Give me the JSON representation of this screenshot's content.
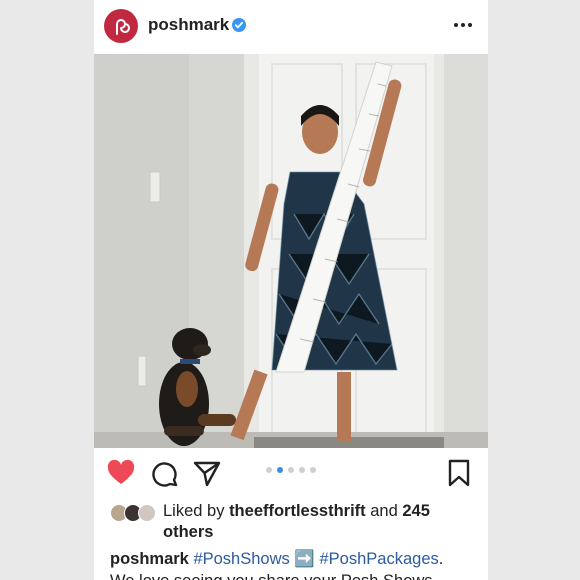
{
  "post": {
    "username": "poshmark",
    "verified": true
  },
  "icons": {
    "avatar": "poshmark-logo-icon",
    "verified": "verified-badge-icon",
    "more": "more-options-icon",
    "like": "heart-icon",
    "comment": "comment-icon",
    "share": "share-icon",
    "save": "bookmark-icon"
  },
  "carousel": {
    "count": 5,
    "active_index": 1
  },
  "likes": {
    "prefix": "Liked by",
    "user": "theeffortlessthrift",
    "middle": "and",
    "count_text": "245 others"
  },
  "caption": {
    "username": "poshmark",
    "tag1": "#PoshShows",
    "arrow": "➡️",
    "tag2": "#PoshPackages",
    "period": ".",
    "line2": "We love seeing you share your Posh Shows"
  },
  "colors": {
    "brand": "#c02940",
    "like": "#ed4956",
    "link": "#2c5aa0",
    "active_dot": "#3b8ee5"
  }
}
